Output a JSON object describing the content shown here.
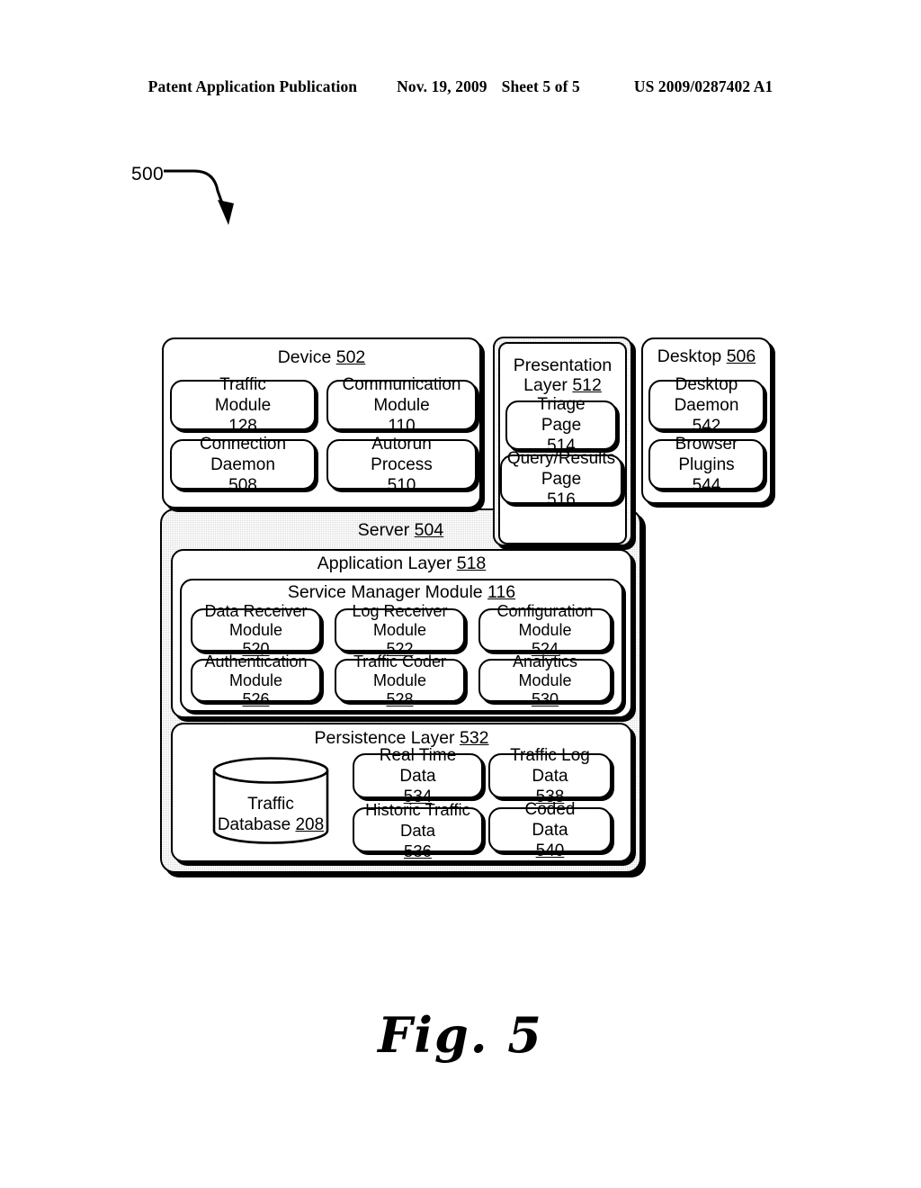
{
  "header": {
    "publication": "Patent Application Publication",
    "date": "Nov. 19, 2009",
    "sheet": "Sheet 5 of 5",
    "patent_number": "US 2009/0287402 A1"
  },
  "figure": {
    "lead_number": "500",
    "caption": "Fig. 5"
  },
  "device": {
    "title": "Device",
    "ref": "502",
    "modules": [
      {
        "line1": "Traffic",
        "line2": "Module ",
        "ref": "128"
      },
      {
        "line1": "Communication",
        "line2": "Module",
        "ref": "110"
      },
      {
        "line1": "Connection",
        "line2": "Daemon ",
        "ref": "508"
      },
      {
        "line1": "Autorun",
        "line2": "Process ",
        "ref": "510"
      }
    ]
  },
  "presentation": {
    "title_line1": "Presentation",
    "title_line2": "Layer ",
    "ref": "512",
    "pages": [
      {
        "line1": "Triage",
        "line2": "Page ",
        "ref": "514"
      },
      {
        "line1": "Query/Results",
        "line2": "Page ",
        "ref": "516"
      }
    ]
  },
  "desktop": {
    "title": "Desktop",
    "ref": "506",
    "items": [
      {
        "line1": "Desktop",
        "line2": "Daemon ",
        "ref": "542"
      },
      {
        "line1": "Browser",
        "line2": "Plugins ",
        "ref": "544"
      }
    ]
  },
  "server": {
    "title": "Server",
    "ref": "504",
    "application_layer": {
      "title": "Application Layer",
      "ref": "518",
      "service_manager": {
        "title": "Service Manager Module",
        "ref": "116",
        "modules": [
          {
            "line1": "Data Receiver",
            "line2": "Module ",
            "ref": "520"
          },
          {
            "line1": "Log Receiver",
            "line2": "Module ",
            "ref": "522"
          },
          {
            "line1": "Configuration",
            "line2": "Module ",
            "ref": "524"
          },
          {
            "line1": "Authentication",
            "line2": "Module ",
            "ref": "526"
          },
          {
            "line1": "Traffic Coder",
            "line2": "Module ",
            "ref": "528"
          },
          {
            "line1": "Analytics",
            "line2": "Module ",
            "ref": "530"
          }
        ]
      }
    },
    "persistence_layer": {
      "title": "Persistence Layer",
      "ref": "532",
      "database": {
        "line1": "Traffic",
        "line2": "Database ",
        "ref": "208"
      },
      "stores": [
        {
          "line1": "Real Time",
          "line2": "Data ",
          "ref": "534"
        },
        {
          "line1": "Traffic Log",
          "line2": "Data ",
          "ref": "538"
        },
        {
          "line1": "Historic Traffic",
          "line2": "Data ",
          "ref": "536"
        },
        {
          "line1": "Coded",
          "line2": "Data ",
          "ref": "540"
        }
      ]
    }
  }
}
